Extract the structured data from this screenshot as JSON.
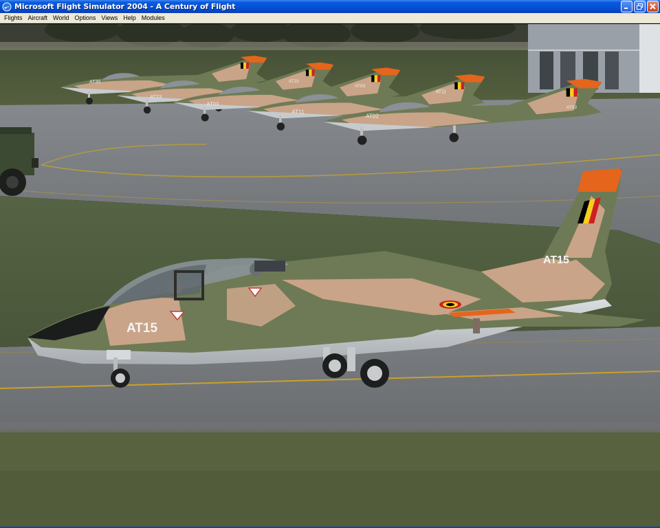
{
  "window": {
    "title": "Microsoft Flight Simulator 2004 - A Century of Flight",
    "icon": "fs-plane-icon"
  },
  "title_buttons": {
    "minimize": "minimize-icon",
    "maximize": "restore-icon",
    "close": "close-icon"
  },
  "menu": {
    "items": [
      "Flights",
      "Aircraft",
      "World",
      "Options",
      "Views",
      "Help",
      "Modules"
    ]
  },
  "scene": {
    "description_colors": {
      "grass": "#5d6a48",
      "tarmac": "#7c7f82",
      "taxi_line": "#c9a22a",
      "camo_green": "#6e7a55",
      "camo_tan": "#c9a488",
      "tail_tip": "#e4651b"
    },
    "aircraft": [
      {
        "code": "AT15"
      },
      {
        "code": "AT02"
      },
      {
        "code": "AT11"
      },
      {
        "code": "AT03"
      },
      {
        "code": "AT23"
      },
      {
        "code": "AT30"
      }
    ]
  }
}
